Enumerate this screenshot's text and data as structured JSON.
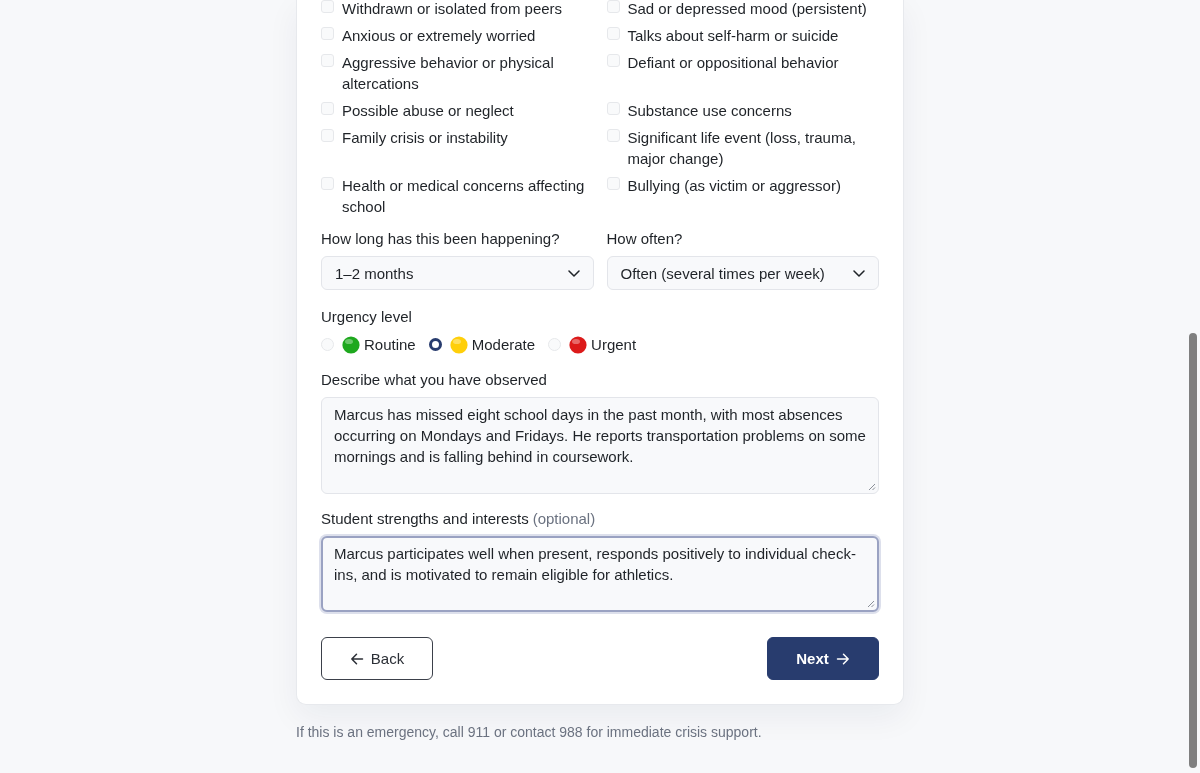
{
  "concerns": [
    {
      "label": "Withdrawn or isolated from peers",
      "checked": false
    },
    {
      "label": "Sad or depressed mood (persistent)",
      "checked": false
    },
    {
      "label": "Anxious or extremely worried",
      "checked": false
    },
    {
      "label": "Talks about self-harm or suicide",
      "checked": false
    },
    {
      "label": "Aggressive behavior or physical altercations",
      "checked": false
    },
    {
      "label": "Defiant or oppositional behavior",
      "checked": false
    },
    {
      "label": "Possible abuse or neglect",
      "checked": false
    },
    {
      "label": "Substance use concerns",
      "checked": false
    },
    {
      "label": "Family crisis or instability",
      "checked": false
    },
    {
      "label": "Significant life event (loss, trauma, major change)",
      "checked": false
    },
    {
      "label": "Health or medical concerns affecting school",
      "checked": false
    },
    {
      "label": "Bullying (as victim or aggressor)",
      "checked": false
    }
  ],
  "selects": [
    {
      "label": "How long has this been happening?",
      "value": "1–2 months"
    },
    {
      "label": "How often?",
      "value": "Often (several times per week)"
    }
  ],
  "urgency": {
    "label": "Urgency level",
    "options": [
      {
        "label": "Routine",
        "color": "#1ea81e",
        "selected": false
      },
      {
        "label": "Moderate",
        "color": "#ffcf0a",
        "selected": true
      },
      {
        "label": "Urgent",
        "color": "#dc1a1a",
        "selected": false
      }
    ]
  },
  "text_areas": [
    {
      "label": "Describe what you have observed",
      "value": "Marcus has missed eight school days in the past month, with most absences occurring on Mondays and Fridays. He reports transportation problems on some mornings and is falling behind in coursework.",
      "focused": false
    },
    {
      "label": "Student strengths and interests",
      "note": "(optional)",
      "value": "Marcus participates well when present, responds positively to individual check-ins, and is motivated to remain eligible for athletics.",
      "focused": true
    }
  ],
  "buttons": [
    {
      "label": "Back",
      "kind": "secondary"
    },
    {
      "label": "Next",
      "kind": "primary"
    }
  ],
  "footer": "If this is an emergency, call 911 or contact 988 for immediate crisis support."
}
